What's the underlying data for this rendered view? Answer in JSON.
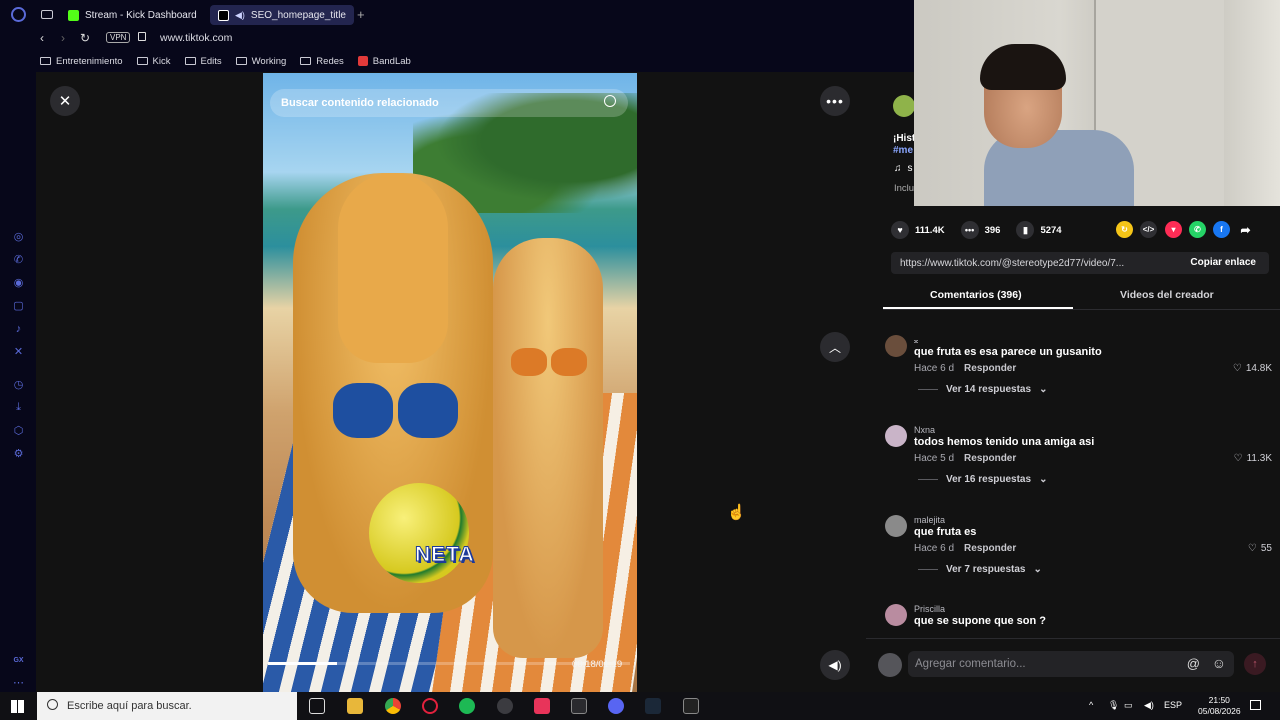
{
  "browser": {
    "tabs": [
      {
        "label": "Stream - Kick Dashboard",
        "favicon_color": "#53fc18"
      },
      {
        "label": "SEO_homepage_title",
        "favicon_color": "#ffffff"
      }
    ],
    "vpn_badge": "VPN",
    "url": "www.tiktok.com",
    "bookmarks": [
      {
        "label": "Entretenimiento",
        "icon": "folder-icon"
      },
      {
        "label": "Kick",
        "icon": "folder-icon"
      },
      {
        "label": "Edits",
        "icon": "folder-icon"
      },
      {
        "label": "Working",
        "icon": "folder-icon"
      },
      {
        "label": "Redes",
        "icon": "folder-icon"
      },
      {
        "label": "BandLab",
        "icon": "bandlab-icon"
      }
    ],
    "sidebar_bottom_label": "GX"
  },
  "video": {
    "search_placeholder": "Buscar contenido relacionado",
    "caption_overlay": "NETA",
    "timecode": "00:18/01:19",
    "progress_fraction": 0.19
  },
  "creator": {
    "desc_line1": "¡Hist",
    "desc_line2": "#me",
    "music_line": "s",
    "included": "Inclu"
  },
  "stats": {
    "likes": "111.4K",
    "comments": "396",
    "saves": "5274"
  },
  "share_link": {
    "url": "https://www.tiktok.com/@stereotype2d77/video/7...",
    "copy_label": "Copiar enlace"
  },
  "panel_tabs": {
    "comments": "Comentarios (396)",
    "creator_videos": "Videos del creador"
  },
  "comments": [
    {
      "user": "𝄪",
      "text": "que fruta es esa parece un gusanito",
      "time": "Hace 6 d",
      "reply": "Responder",
      "likes": "14.8K",
      "replies": "Ver 14 respuestas",
      "avatar_color": "#6a4e3c"
    },
    {
      "user": "Nxna",
      "text": "todos hemos tenido una amiga asi",
      "time": "Hace 5 d",
      "reply": "Responder",
      "likes": "11.3K",
      "replies": "Ver 16 respuestas",
      "avatar_color": "#c9b4c8"
    },
    {
      "user": "malejita",
      "text": "que fruta es",
      "time": "Hace 6 d",
      "reply": "Responder",
      "likes": "55",
      "replies": "Ver 7 respuestas",
      "avatar_color": "#8a8a8a"
    },
    {
      "user": "Priscilla",
      "text": "que se supone que son ?",
      "time": "",
      "reply": "",
      "likes": "",
      "replies": "",
      "avatar_color": "#b98ca0"
    }
  ],
  "add_comment": {
    "placeholder": "Agregar comentario..."
  },
  "taskbar": {
    "search_placeholder": "Escribe aquí para buscar.",
    "lang": "ESP",
    "time": "21:50",
    "date": "05/08/2026"
  }
}
